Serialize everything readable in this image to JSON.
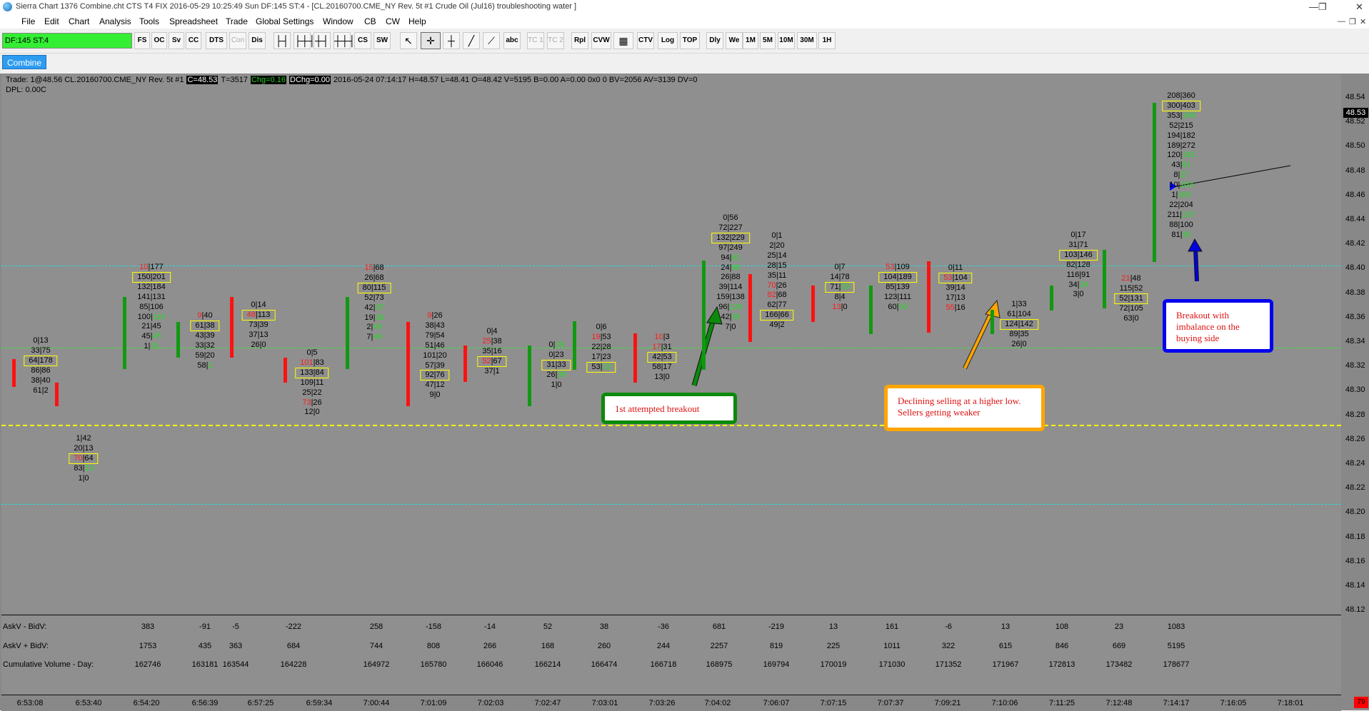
{
  "window": {
    "title": "Sierra Chart 1376 Combine.cht  CTS T4 FIX 2016-05-29  10:25:49 Sun  DF:145  ST:4 - [CL.20160700.CME_NY  Rev. 5t  #1  Crude Oil (Jul16)  troubleshooting water ]",
    "minimize": "—",
    "restore": "❐",
    "close": "✕"
  },
  "menu": [
    "File",
    "Edit",
    "Chart",
    "Analysis",
    "Tools",
    "Spreadsheet",
    "Trade",
    "Global Settings",
    "Window",
    "CB",
    "CW",
    "Help"
  ],
  "toolbar": {
    "df_status": "DF:145  ST:4",
    "buttons": [
      "FS",
      "OC",
      "Sv",
      "CC",
      "DTS",
      "Con",
      "Dis",
      "├┤",
      "├┼┤",
      "┼┤",
      "┼┼┤",
      "CS",
      "SW",
      "↖",
      "✛",
      "┼",
      "╱",
      "⟋",
      "abc",
      "TC 1",
      "TC 2",
      "Rpl",
      "CVW",
      "▦",
      "CTV",
      "Log",
      "TOP",
      "Dly",
      "We",
      "1M",
      "5M",
      "10M",
      "30M",
      "1H"
    ]
  },
  "tab": "Combine",
  "status": {
    "trade": "Trade: 1@48.56  CL.20160700.CME_NY  Rev. 5t  #1",
    "close": "C=48.53",
    "t": "T=3517",
    "chg": "Chg=0.16",
    "dchg": "DChg=0.00",
    "rest": "2016-05-24 07:14:17  H=48.57  L=48.41  O=48.42  V=5195  B=0.00  A=0.00  0x0 0  BV=2056  AV=3139  DV=0",
    "dpl": "DPL: 0.00C"
  },
  "price_axis": {
    "ticks": [
      "48.54",
      "48.52",
      "48.50",
      "48.48",
      "48.46",
      "48.44",
      "48.42",
      "48.40",
      "48.38",
      "48.36",
      "48.34",
      "48.32",
      "48.30",
      "48.28",
      "48.26",
      "48.24",
      "48.22",
      "48.20",
      "48.18",
      "48.16",
      "48.14",
      "48.12"
    ],
    "last_price": "48.53"
  },
  "callouts": {
    "breakout1": "1st attempted breakout",
    "declining": "Declining selling at a higher low.  Sellers getting weaker",
    "breakout2": "Breakout with imbalance on the buying side"
  },
  "footer": {
    "labels": [
      "AskV - BidV:",
      "AskV + BidV:",
      "Cumulative Volume - Day:"
    ],
    "delta": [
      "383",
      "-91",
      "-5",
      "-222",
      "258",
      "-158",
      "-14",
      "52",
      "38",
      "-36",
      "681",
      "-219",
      "13",
      "161",
      "-6",
      "13",
      "108",
      "23",
      "1083"
    ],
    "total": [
      "1753",
      "435",
      "363",
      "684",
      "744",
      "808",
      "266",
      "168",
      "260",
      "244",
      "2257",
      "819",
      "225",
      "1011",
      "322",
      "615",
      "846",
      "669",
      "5195"
    ],
    "cumulative": [
      "162746",
      "163181",
      "163544",
      "164228",
      "164972",
      "165780",
      "166046",
      "166214",
      "166474",
      "166718",
      "168975",
      "169794",
      "170019",
      "171030",
      "171352",
      "171967",
      "172813",
      "173482",
      "178677"
    ]
  },
  "time_axis": [
    "6:53:08",
    "6:53:40",
    "6:54:20",
    "6:56:39",
    "6:57:25",
    "6:59:34",
    "7:00:44",
    "7:01:09",
    "7:02:03",
    "7:02:47",
    "7:03:01",
    "7:03:26",
    "7:04:02",
    "7:06:07",
    "7:07:15",
    "7:07:37",
    "7:09:21",
    "7:10:06",
    "7:11:25",
    "7:12:48",
    "7:14:17",
    "7:16:05",
    "7:18:01"
  ],
  "corner_badge": "79",
  "bars": [
    {
      "dir": "dn",
      "cells": [
        {
          "t": "0|13"
        },
        {
          "t": "33|75"
        },
        {
          "t": "64|178",
          "box": true
        },
        {
          "t": "86|86"
        },
        {
          "t": "38|40"
        },
        {
          "t": "61|2"
        }
      ]
    },
    {
      "dir": "dn",
      "cells": [
        {
          "t": "1|42"
        },
        {
          "t": "20|13"
        },
        {
          "t": "70|64",
          "box": true,
          "red": true
        },
        {
          "t": "83|13",
          "green": true
        },
        {
          "t": "1|0"
        }
      ]
    },
    {
      "dir": "up",
      "cells": [
        {
          "t": "10|177",
          "red": true
        },
        {
          "t": "150|201",
          "box": true
        },
        {
          "t": "132|184"
        },
        {
          "t": "141|131"
        },
        {
          "t": "85|106"
        },
        {
          "t": "100|114",
          "green": true
        },
        {
          "t": "21|45"
        },
        {
          "t": "45|45",
          "green": true
        },
        {
          "t": "1|10",
          "green": true
        }
      ]
    },
    {
      "dir": "up",
      "cells": [
        {
          "t": "9|40",
          "red": true
        },
        {
          "t": "61|38",
          "box": true
        },
        {
          "t": "43|39"
        },
        {
          "t": "33|32"
        },
        {
          "t": "59|20"
        },
        {
          "t": "58|1",
          "green": true
        }
      ]
    },
    {
      "dir": "dn",
      "cells": [
        {
          "t": "0|14"
        },
        {
          "t": "48|113",
          "box": true,
          "red": true
        },
        {
          "t": "73|39"
        },
        {
          "t": "37|13"
        },
        {
          "t": "26|0"
        }
      ]
    },
    {
      "dir": "dn",
      "cells": [
        {
          "t": "0|5"
        },
        {
          "t": "101|83",
          "red": true
        },
        {
          "t": "133|84",
          "box": true
        },
        {
          "t": "109|11"
        },
        {
          "t": "25|22"
        },
        {
          "t": "73|26",
          "red": true
        },
        {
          "t": "12|0"
        }
      ]
    },
    {
      "dir": "up",
      "cells": [
        {
          "t": "15|68",
          "red": true
        },
        {
          "t": "26|68"
        },
        {
          "t": "80|115",
          "box": true
        },
        {
          "t": "52|73"
        },
        {
          "t": "42|37",
          "green": true
        },
        {
          "t": "19|26",
          "green": true
        },
        {
          "t": "2|49",
          "green": true
        },
        {
          "t": "7|49",
          "green": true
        }
      ]
    },
    {
      "dir": "dn",
      "cells": [
        {
          "t": "9|26",
          "red": true
        },
        {
          "t": "38|43"
        },
        {
          "t": "79|54"
        },
        {
          "t": "51|46"
        },
        {
          "t": "101|20"
        },
        {
          "t": "57|39"
        },
        {
          "t": "92|76",
          "box": true
        },
        {
          "t": "47|12"
        },
        {
          "t": "9|0"
        }
      ]
    },
    {
      "dir": "dn",
      "cells": [
        {
          "t": "0|4"
        },
        {
          "t": "25|38",
          "red": true
        },
        {
          "t": "35|16"
        },
        {
          "t": "52|67",
          "box": true,
          "red": true
        },
        {
          "t": "37|1"
        }
      ]
    },
    {
      "dir": "up",
      "cells": [
        {
          "t": "0|26",
          "green": true
        },
        {
          "t": "0|23"
        },
        {
          "t": "31|33",
          "box": true
        },
        {
          "t": "26|39",
          "green": true
        },
        {
          "t": "1|0"
        }
      ]
    },
    {
      "dir": "up",
      "cells": [
        {
          "t": "0|6"
        },
        {
          "t": "19|53",
          "red": true
        },
        {
          "t": "22|28"
        },
        {
          "t": "17|23"
        },
        {
          "t": "53|33",
          "box": true,
          "green": true
        }
      ]
    },
    {
      "dir": "dn",
      "cells": [
        {
          "t": "10|3",
          "red": true
        },
        {
          "t": "17|31",
          "red": true
        },
        {
          "t": "42|53",
          "box": true
        },
        {
          "t": "58|17"
        },
        {
          "t": "13|0"
        }
      ]
    },
    {
      "dir": "up",
      "cells": [
        {
          "t": "0|56"
        },
        {
          "t": "72|227"
        },
        {
          "t": "132|229",
          "box": true
        },
        {
          "t": "97|249"
        },
        {
          "t": "94|61",
          "green": true
        },
        {
          "t": "24|60",
          "green": true
        },
        {
          "t": "26|88"
        },
        {
          "t": "39|114"
        },
        {
          "t": "159|138"
        },
        {
          "t": "96|120",
          "green": true
        },
        {
          "t": "42|50",
          "green": true
        },
        {
          "t": "7|0"
        }
      ]
    },
    {
      "dir": "dn",
      "cells": [
        {
          "t": "0|1"
        },
        {
          "t": "2|20"
        },
        {
          "t": "25|14"
        },
        {
          "t": "28|15"
        },
        {
          "t": "35|11"
        },
        {
          "t": "70|26",
          "red": true
        },
        {
          "t": "82|68",
          "red": true
        },
        {
          "t": "62|77"
        },
        {
          "t": "166|66",
          "box": true
        },
        {
          "t": "49|2"
        }
      ]
    },
    {
      "dir": "dn",
      "cells": [
        {
          "t": "0|7"
        },
        {
          "t": "14|78"
        },
        {
          "t": "71|30",
          "box": true,
          "green": true
        },
        {
          "t": "8|4"
        },
        {
          "t": "13|0",
          "red": true
        }
      ]
    },
    {
      "dir": "up",
      "cells": [
        {
          "t": "53|109",
          "red": true
        },
        {
          "t": "104|189",
          "box": true
        },
        {
          "t": "85|139"
        },
        {
          "t": "123|111"
        },
        {
          "t": "60|50",
          "green": true
        }
      ]
    },
    {
      "dir": "dn",
      "cells": [
        {
          "t": "0|11"
        },
        {
          "t": "53|104",
          "box": true,
          "red": true
        },
        {
          "t": "39|14"
        },
        {
          "t": "17|13"
        },
        {
          "t": "55|16",
          "red": true
        }
      ]
    },
    {
      "dir": "up",
      "cells": [
        {
          "t": "1|33"
        },
        {
          "t": "61|104"
        },
        {
          "t": "124|142",
          "box": true
        },
        {
          "t": "89|35"
        },
        {
          "t": "26|0"
        }
      ]
    },
    {
      "dir": "up",
      "cells": [
        {
          "t": "0|17"
        },
        {
          "t": "31|71"
        },
        {
          "t": "103|146",
          "box": true
        },
        {
          "t": "82|128"
        },
        {
          "t": "116|91"
        },
        {
          "t": "34|24",
          "green": true
        },
        {
          "t": "3|0"
        }
      ]
    },
    {
      "dir": "up",
      "cells": [
        {
          "t": "21|48",
          "red": true
        },
        {
          "t": "115|52"
        },
        {
          "t": "52|131",
          "box": true
        },
        {
          "t": "72|105"
        },
        {
          "t": "63|0"
        }
      ]
    },
    {
      "dir": "up",
      "cells": [
        {
          "t": "208|360"
        },
        {
          "t": "300|403",
          "box": true
        },
        {
          "t": "353|198",
          "green": true
        },
        {
          "t": "52|215"
        },
        {
          "t": "194|182"
        },
        {
          "t": "189|272"
        },
        {
          "t": "120|181",
          "green": true
        },
        {
          "t": "43|81",
          "green": true
        },
        {
          "t": "8|27",
          "green": true
        },
        {
          "t": "10|103",
          "green": true
        },
        {
          "t": "1|103",
          "green": true
        },
        {
          "t": "22|204"
        },
        {
          "t": "211|107",
          "green": true
        },
        {
          "t": "88|100"
        },
        {
          "t": "81|30",
          "green": true
        }
      ]
    }
  ]
}
